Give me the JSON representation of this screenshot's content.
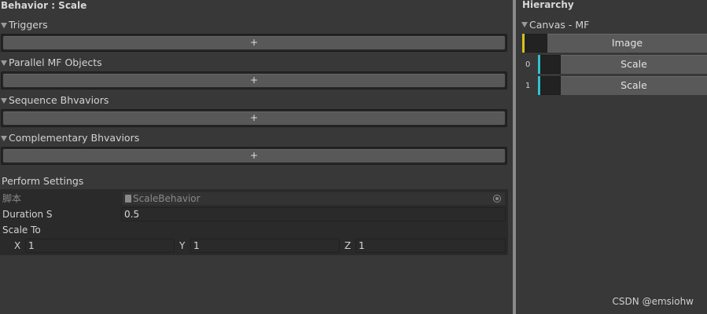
{
  "inspector": {
    "title": "Behavior : Scale",
    "lists": [
      {
        "label": "Triggers",
        "add": "+"
      },
      {
        "label": "Parallel MF Objects",
        "add": "+"
      },
      {
        "label": "Sequence Bhvaviors",
        "add": "+"
      },
      {
        "label": "Complementary Bhvaviors",
        "add": "+"
      }
    ],
    "perform_settings": {
      "label": "Perform Settings",
      "script_label": "脚本",
      "script_value": "ScaleBehavior",
      "duration_label": "Duration S",
      "duration_value": "0.5",
      "scale_to_label": "Scale To",
      "x_label": "X",
      "x_value": "1",
      "y_label": "Y",
      "y_value": "1",
      "z_label": "Z",
      "z_value": "1"
    }
  },
  "hierarchy": {
    "title": "Hierarchy",
    "group": "Canvas - MF",
    "rows": [
      {
        "index": "",
        "label": "Image",
        "bar_color": "#d6c21b"
      },
      {
        "index": "0",
        "label": "Scale",
        "bar_color": "#2ec4d0"
      },
      {
        "index": "1",
        "label": "Scale",
        "bar_color": "#2ec4d0"
      }
    ]
  },
  "watermark": "CSDN @emsiohw"
}
